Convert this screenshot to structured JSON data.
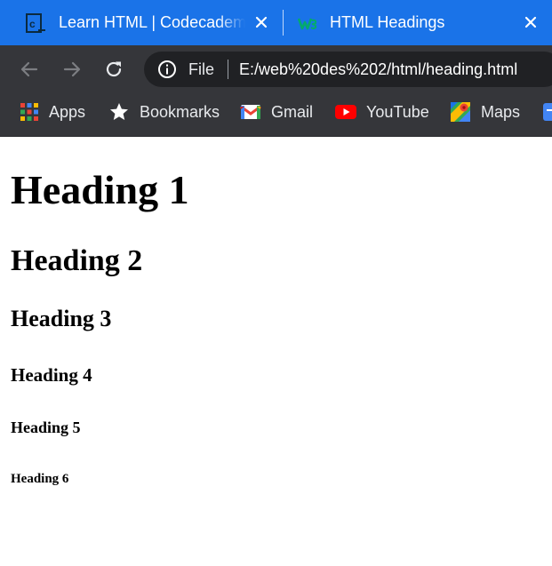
{
  "browser": {
    "tabs": [
      {
        "title": "Learn HTML | Codecademy",
        "favicon": "codecademy-icon",
        "close": "close-icon"
      },
      {
        "title": "HTML Headings",
        "favicon": "w3schools-icon",
        "close": "close-icon"
      }
    ],
    "toolbar": {
      "back": "arrow-left-icon",
      "forward": "arrow-right-icon",
      "reload": "reload-icon",
      "site_info": "info-icon",
      "scheme_label": "File",
      "url": "E:/web%20des%202/html/heading.html"
    },
    "bookmarks": [
      {
        "label": "Apps",
        "icon": "apps-grid-icon"
      },
      {
        "label": "Bookmarks",
        "icon": "star-icon"
      },
      {
        "label": "Gmail",
        "icon": "gmail-icon"
      },
      {
        "label": "YouTube",
        "icon": "youtube-icon"
      },
      {
        "label": "Maps",
        "icon": "maps-icon"
      }
    ],
    "colors": {
      "tab_strip": "#1a73e8",
      "toolbar": "#35363a",
      "omnibox": "#202124"
    }
  },
  "page": {
    "h1": "Heading 1",
    "h2": "Heading 2",
    "h3": "Heading 3",
    "h4": "Heading 4",
    "h5": "Heading 5",
    "h6": "Heading 6"
  }
}
